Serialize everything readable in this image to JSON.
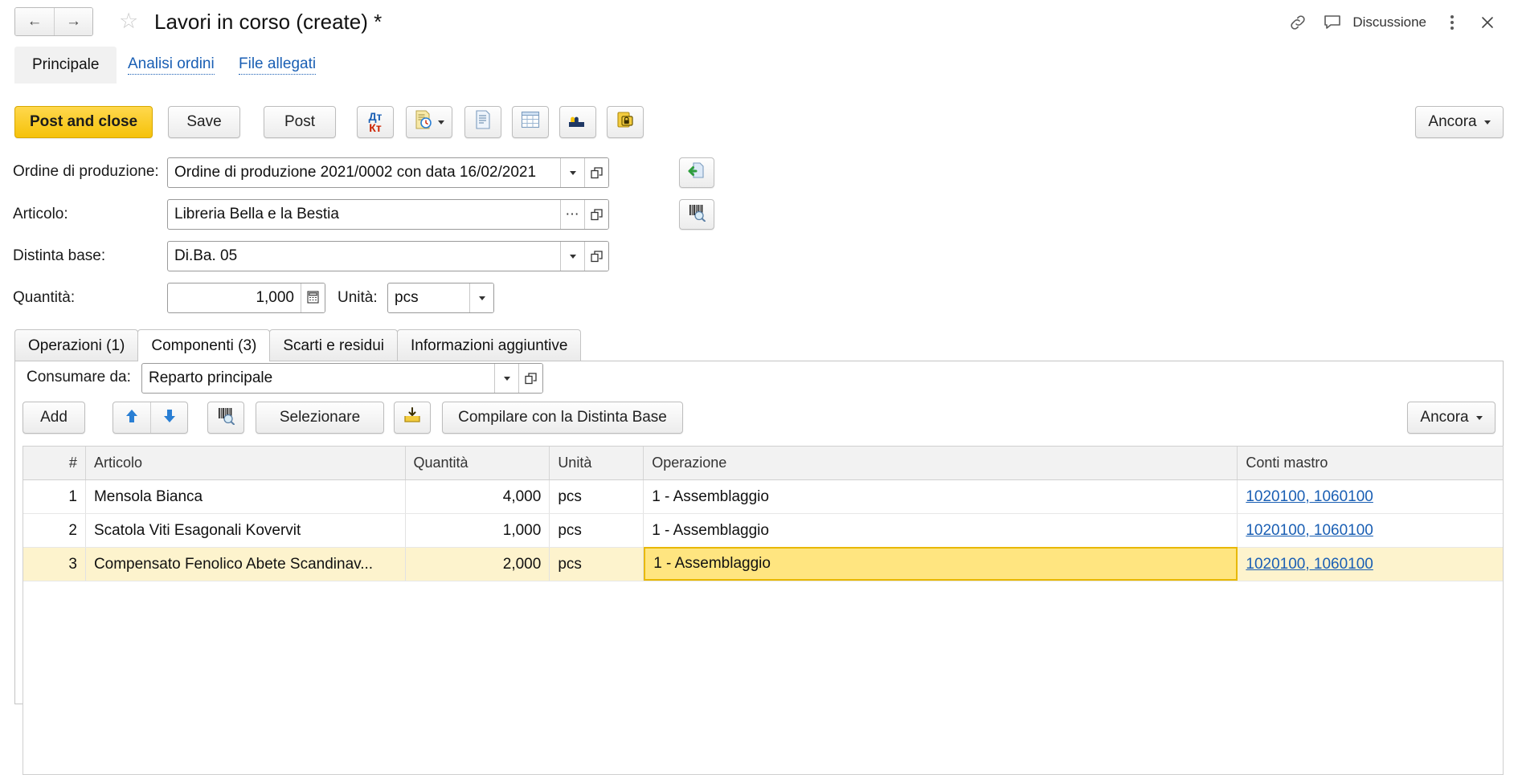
{
  "titlebar": {
    "back_icon": "arrow-left-icon",
    "forward_icon": "arrow-right-icon",
    "favorite_icon": "star-icon",
    "title": "Lavori in corso (create) *",
    "link_icon": "link-icon",
    "discussion_icon": "speech-bubble-icon",
    "discussion_label": "Discussione",
    "more_icon": "kebab-menu-icon",
    "close_icon": "close-icon"
  },
  "page_tabs": [
    {
      "label": "Principale",
      "active": true
    },
    {
      "label": "Analisi ordini",
      "active": false
    },
    {
      "label": "File allegati",
      "active": false
    }
  ],
  "command_bar": {
    "post_and_close": "Post and close",
    "save": "Save",
    "post": "Post",
    "dt_kt_icon": "debit-credit-icon",
    "dt_label": "Дт",
    "kt_label": "Кт",
    "report_clock_icon": "document-clock-icon",
    "document_icon": "document-list-icon",
    "table_icon": "spreadsheet-icon",
    "puzzle_icon": "puzzle-icon",
    "lock_folder_icon": "locked-print-icon",
    "more_label": "Ancora",
    "more_caret_icon": "caret-down-icon"
  },
  "form": {
    "order_label": "Ordine di produzione:",
    "order_value": "Ordine di produzione 2021/0002 con data 16/02/2021",
    "order_dropdown_icon": "caret-down-icon",
    "order_open_icon": "open-window-icon",
    "order_side_icon": "fill-from-document-icon",
    "item_label": "Articolo:",
    "item_value": "Libreria Bella e la Bestia",
    "item_ellipsis_icon": "ellipsis-icon",
    "item_open_icon": "open-window-icon",
    "item_side_icon": "barcode-scan-icon",
    "bom_label": "Distinta base:",
    "bom_value": "Di.Ba. 05",
    "bom_dropdown_icon": "caret-down-icon",
    "bom_open_icon": "open-window-icon",
    "qty_label": "Quantità:",
    "qty_value": "1,000",
    "qty_calc_icon": "calculator-icon",
    "unit_label": "Unità:",
    "unit_value": "pcs",
    "unit_dropdown_icon": "caret-down-icon"
  },
  "inner_tabs": [
    {
      "label": "Operazioni (1)",
      "active": false
    },
    {
      "label": "Componenti (3)",
      "active": true
    },
    {
      "label": "Scarti e residui",
      "active": false
    },
    {
      "label": "Informazioni aggiuntive",
      "active": false
    }
  ],
  "panel": {
    "consume_label": "Consumare da:",
    "consume_value": "Reparto principale",
    "consume_dropdown_icon": "caret-down-icon",
    "consume_open_icon": "open-window-icon",
    "toolbar": {
      "add": "Add",
      "move_up_icon": "arrow-up-icon",
      "move_down_icon": "arrow-down-icon",
      "barcode_icon": "barcode-scan-icon",
      "select": "Selezionare",
      "download_icon": "fill-in-icon",
      "fill_bom": "Compilare con la Distinta Base",
      "more_label": "Ancora",
      "more_caret_icon": "caret-down-icon"
    }
  },
  "grid": {
    "columns": [
      "#",
      "Articolo",
      "Quantità",
      "Unità",
      "Operazione",
      "Conti mastro"
    ],
    "rows": [
      {
        "index": "1",
        "articolo": "Mensola Bianca",
        "quantita": "4,000",
        "unita": "pcs",
        "operazione": "1 - Assemblaggio",
        "conti_mastro": "1020100, 1060100",
        "selected": false
      },
      {
        "index": "2",
        "articolo": "Scatola Viti Esagonali Kovervit",
        "quantita": "1,000",
        "unita": "pcs",
        "operazione": "1 - Assemblaggio",
        "conti_mastro": "1020100, 1060100",
        "selected": false
      },
      {
        "index": "3",
        "articolo": "Compensato Fenolico Abete Scandinav...",
        "quantita": "2,000",
        "unita": "pcs",
        "operazione": "1 - Assemblaggio",
        "conti_mastro": "1020100, 1060100",
        "selected": true
      }
    ]
  },
  "colors": {
    "accent_yellow": "#f5c20a",
    "selected_row": "#fdf3cd",
    "selected_cell": "#ffe580",
    "selected_cell_border": "#e8b800",
    "link_blue": "#1a5fb4"
  }
}
